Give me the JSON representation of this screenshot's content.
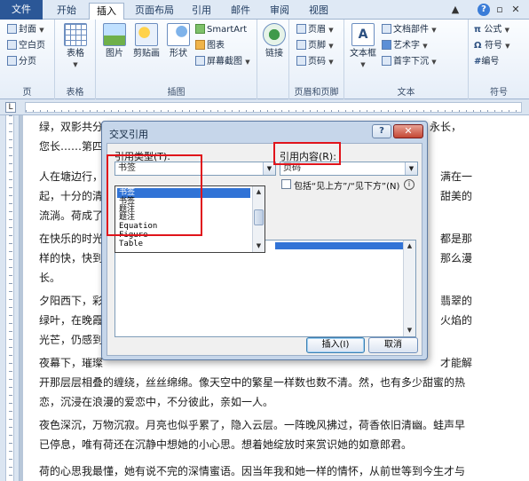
{
  "tabs": [
    "文件",
    "开始",
    "插入",
    "页面布局",
    "引用",
    "邮件",
    "审阅",
    "视图"
  ],
  "active_tab": "插入",
  "ribbon": {
    "pages_items": [
      "封面",
      "空白页",
      "分页"
    ],
    "pages_label": "页",
    "table_label": "表格",
    "table_button": "表格",
    "illus_buttons": [
      "图片",
      "剪贴画",
      "形状"
    ],
    "illus_small": [
      "SmartArt",
      "图表",
      "屏幕截图"
    ],
    "illus_label": "插图",
    "links_button": "链接",
    "header_items": [
      "页眉",
      "页脚",
      "页码"
    ],
    "header_label": "页眉和页脚",
    "textbox_button": "文本框",
    "text_items": [
      "文档部件",
      "艺术字",
      "首字下沉"
    ],
    "text_label": "文本",
    "symbol_items": [
      "公式",
      "符号",
      "编号"
    ],
    "symbol_label": "符号"
  },
  "document": {
    "paragraphs": [
      "绿，双影共分",
      "您长……第四",
      "人在塘边行，",
      "起，十分的清",
      "流淌。荷成了",
      "在快乐的时光",
      "样的快，快到",
      "长。",
      "夕阳西下，彩",
      "绿叶，在晚霞",
      "光芒，仍感到",
      "夜幕下，璀璨",
      "开那层层相叠的缠绕，丝丝绵绵。像天空中的繁星一样数也数不清。然，也有多少甜蜜的热",
      "恋，沉浸在浪漫的爱恋中，不分彼此，亲如一人。",
      "夜色深沉，万物沉寂。月亮也似乎累了，隐入云层。一阵晚风拂过，荷香依旧清幽。蛙声早",
      "已停息，唯有荷还在沉静中想她的小心思。想着她绽放时来赏识她的如意郎君。",
      "荷的心思我最懂，她有说不完的深情蜜语。因当年我和她一样的情怀，从前世等到今生才与"
    ],
    "right_fragments": [
      "永长，",
      "满在一",
      "甜美的",
      "都是那",
      "那么漫",
      "翡翠的",
      "火焰的",
      "才能解"
    ]
  },
  "dialog": {
    "title": "交叉引用",
    "help": "?",
    "close": "✕",
    "ref_type_label": "引用类型(T):",
    "ref_type_value": "书签",
    "ref_content_label": "引用内容(R):",
    "ref_content_value": "页码",
    "dropdown_options": [
      "书签",
      "书签",
      "题注",
      "题注",
      "Equation",
      "Figure",
      "Table"
    ],
    "selected_option": "书签",
    "checkbox_label": "包括“见上方”/“见下方”(N)",
    "insert_button": "插入(I)",
    "cancel_button": "取消"
  }
}
